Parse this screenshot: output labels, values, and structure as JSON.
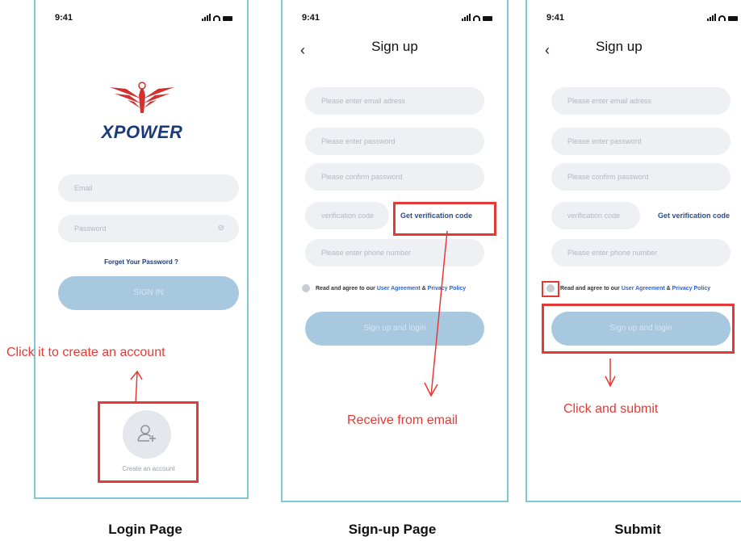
{
  "status": {
    "time": "9:41"
  },
  "login": {
    "brand": "XPOWER",
    "email_placeholder": "Email",
    "password_placeholder": "Password",
    "forgot": "Forget Your Password ?",
    "signin": "SIGN IN",
    "create_account": "Create an account",
    "annotation": "Click it to create an account"
  },
  "signup": {
    "title": "Sign up",
    "email_placeholder": "Please enter email adress",
    "password_placeholder": "Please enter password",
    "confirm_placeholder": "Please confirm password",
    "code_placeholder": "verification code",
    "get_code": "Get verification code",
    "phone_placeholder": "Please  enter phone number",
    "agree_prefix": "Read and agree to our",
    "user_agreement": "User Agreement",
    "amp": "&",
    "privacy_policy": "Privacy Policy",
    "submit": "Sign up and login",
    "annotation": "Receive from email"
  },
  "submit_page": {
    "annotation": "Click and submit"
  },
  "captions": {
    "login": "Login Page",
    "signup": "Sign-up Page",
    "submit": "Submit"
  },
  "colors": {
    "annotation_red": "#e53935",
    "frame_teal": "#7ec8cf",
    "button_blue": "#a8c8e0",
    "link_blue": "#2f63c9",
    "brand_navy": "#1b3a7a",
    "brand_red": "#d32f2f"
  }
}
